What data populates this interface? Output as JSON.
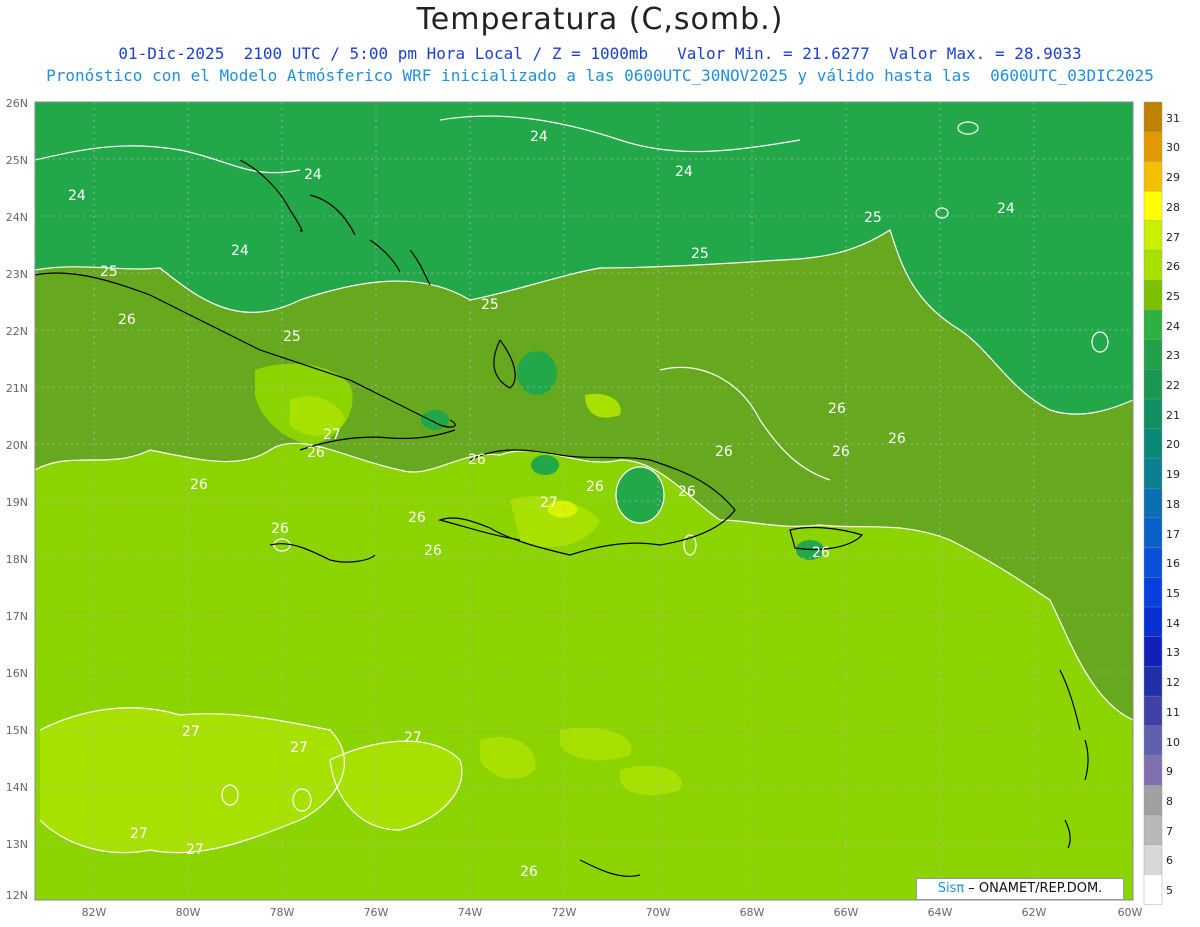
{
  "header": {
    "title": "Temperatura (C,somb.)",
    "line1": "01-Dic-2025  2100 UTC / 5:00 pm Hora Local / Z = 1000mb   Valor Min. = 21.6277  Valor Max. = 28.9033",
    "line2": "Pronóstico con el Modelo Atmósferico WRF inicializado a las 0600UTC_30NOV2025 y válido hasta las  0600UTC_03DIC2025"
  },
  "axes": {
    "lat_labels": [
      "26N",
      "25N",
      "24N",
      "23N",
      "22N",
      "21N",
      "20N",
      "19N",
      "18N",
      "17N",
      "16N",
      "15N",
      "14N",
      "13N",
      "12N"
    ],
    "lon_labels": [
      "82W",
      "80W",
      "78W",
      "76W",
      "74W",
      "72W",
      "70W",
      "68W",
      "66W",
      "64W",
      "62W",
      "60W"
    ]
  },
  "colorbar": {
    "labels": [
      "31",
      "30",
      "29",
      "28",
      "27",
      "26",
      "25",
      "24",
      "23",
      "22",
      "21",
      "20",
      "19",
      "18",
      "17",
      "16",
      "15",
      "14",
      "13",
      "12",
      "11",
      "10",
      "9",
      "8",
      "7",
      "6",
      "5"
    ],
    "colors": [
      "#c08000",
      "#e09a00",
      "#f5c000",
      "#ffff00",
      "#c8f000",
      "#a8e000",
      "#7cc000",
      "#2fb040",
      "#22a048",
      "#189850",
      "#109060",
      "#0a8878",
      "#088090",
      "#0a70b0",
      "#0860c8",
      "#0850d8",
      "#0840e0",
      "#0830d0",
      "#1020b8",
      "#2030a8",
      "#4040a8",
      "#6060b0",
      "#8070b0",
      "#a0a0a0",
      "#b8b8b8",
      "#d8d8d8",
      "#ffffff"
    ]
  },
  "contour_labels": [
    "24",
    "24",
    "24",
    "24",
    "24",
    "24",
    "25",
    "25",
    "25",
    "25",
    "25",
    "26",
    "26",
    "26",
    "26",
    "26",
    "26",
    "26",
    "26",
    "26",
    "26",
    "26",
    "26",
    "26",
    "26",
    "27",
    "27",
    "27",
    "27",
    "27",
    "27",
    "27",
    "26"
  ],
  "colors": {
    "t24": "#22a848",
    "t25": "#66a81e",
    "t26": "#8cd400",
    "t27": "#a8e000",
    "t28": "#d8f400",
    "contour": "#ffffff",
    "coast": "#000000"
  },
  "credit": {
    "sis": "Sisπ",
    "org": " – ONAMET/REP.DOM."
  }
}
